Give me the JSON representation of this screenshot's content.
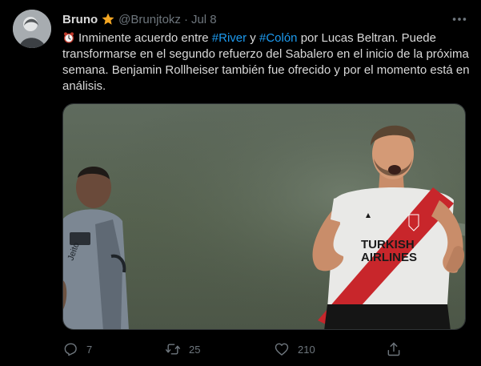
{
  "author": {
    "display_name": "Bruno",
    "handle": "@Brunjtokz",
    "separator": "·",
    "date": "Jul 8"
  },
  "icons": {
    "badge": "star-icon",
    "more": "more-icon",
    "emoji": "alarm-clock-icon",
    "reply": "reply-icon",
    "retweet": "retweet-icon",
    "like": "like-icon",
    "share": "share-icon"
  },
  "tweet": {
    "text_1": "Inminente acuerdo entre ",
    "hashtag_1": "#River",
    "text_2": " y ",
    "hashtag_2": "#Colón",
    "text_3": " por Lucas Beltran. Puede transformarse en el segundo refuerzo del Sabalero en el inicio de la próxima semana. Benjamin Rollheiser también fue ofrecido y por el momento está en análisis."
  },
  "media": {
    "jersey_text_1": "TURKISH",
    "jersey_text_2": "AIRLINES"
  },
  "stats": {
    "replies": "7",
    "retweets": "25",
    "likes": "210"
  },
  "colors": {
    "background": "#000000",
    "text": "#d9d9d9",
    "secondary": "#6e767d",
    "link": "#1d9bf0",
    "star": "#f4a623"
  }
}
